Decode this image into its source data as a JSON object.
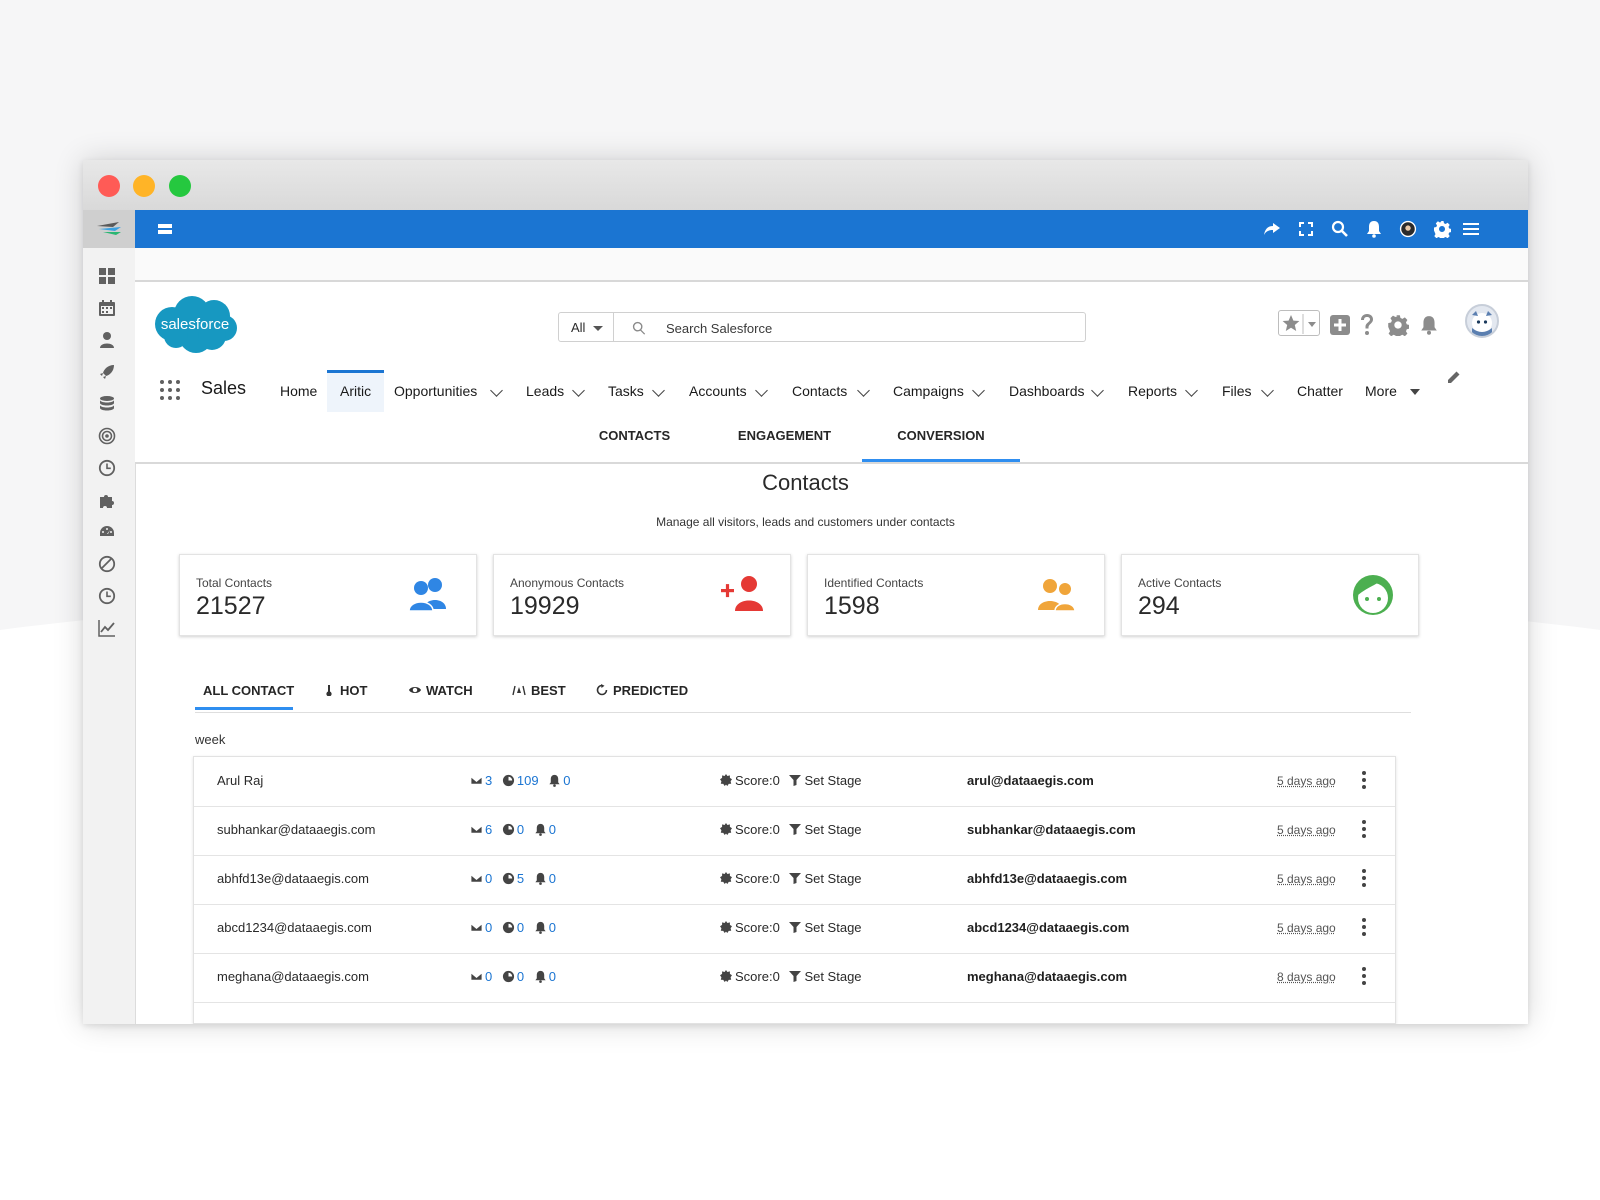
{
  "app": {
    "name": "Sales"
  },
  "search": {
    "scope": "All",
    "placeholder": "Search Salesforce"
  },
  "nav": {
    "items": [
      {
        "label": "Home",
        "dropdown": false
      },
      {
        "label": "Aritic",
        "dropdown": false,
        "active": true
      },
      {
        "label": "Opportunities",
        "dropdown": true
      },
      {
        "label": "Leads",
        "dropdown": true
      },
      {
        "label": "Tasks",
        "dropdown": true
      },
      {
        "label": "Accounts",
        "dropdown": true
      },
      {
        "label": "Contacts",
        "dropdown": true
      },
      {
        "label": "Campaigns",
        "dropdown": true
      },
      {
        "label": "Dashboards",
        "dropdown": true
      },
      {
        "label": "Reports",
        "dropdown": true
      },
      {
        "label": "Files",
        "dropdown": true
      },
      {
        "label": "Chatter",
        "dropdown": false
      },
      {
        "label": "More",
        "dropdown": true
      }
    ]
  },
  "subtabs": [
    {
      "label": "CONTACTS"
    },
    {
      "label": "ENGAGEMENT"
    },
    {
      "label": "CONVERSION",
      "active": true
    }
  ],
  "page": {
    "title": "Contacts",
    "subtitle": "Manage all visitors, leads and customers under contacts"
  },
  "stats": [
    {
      "label": "Total Contacts",
      "value": "21527",
      "icon": "people-icon",
      "color": "#2f86e4"
    },
    {
      "label": "Anonymous Contacts",
      "value": "19929",
      "icon": "add-person-icon",
      "color": "#e53935"
    },
    {
      "label": "Identified Contacts",
      "value": "1598",
      "icon": "people-icon",
      "color": "#f0a53a"
    },
    {
      "label": "Active Contacts",
      "value": "294",
      "icon": "smiley-face-icon",
      "color": "#4caf50"
    }
  ],
  "filter_tabs": [
    {
      "label": "ALL CONTACT",
      "icon": "",
      "active": true
    },
    {
      "label": "HOT",
      "icon": "thermometer-icon"
    },
    {
      "label": "WATCH",
      "icon": "eye-icon"
    },
    {
      "label": "BEST",
      "icon": "badge-icon"
    },
    {
      "label": "PREDICTED",
      "icon": "refresh-icon"
    }
  ],
  "group_label": "week",
  "contacts": [
    {
      "name": "Arul Raj",
      "emails": "3",
      "visits": "109",
      "alerts": "0",
      "score": "Score:0",
      "stage": "Set Stage",
      "email": "arul@dataaegis.com",
      "time": "5 days ago"
    },
    {
      "name": "subhankar@dataaegis.com",
      "emails": "6",
      "visits": "0",
      "alerts": "0",
      "score": "Score:0",
      "stage": "Set Stage",
      "email": "subhankar@dataaegis.com",
      "time": "5 days ago"
    },
    {
      "name": "abhfd13e@dataaegis.com",
      "emails": "0",
      "visits": "5",
      "alerts": "0",
      "score": "Score:0",
      "stage": "Set Stage",
      "email": "abhfd13e@dataaegis.com",
      "time": "5 days ago"
    },
    {
      "name": "abcd1234@dataaegis.com",
      "emails": "0",
      "visits": "0",
      "alerts": "0",
      "score": "Score:0",
      "stage": "Set Stage",
      "email": "abcd1234@dataaegis.com",
      "time": "5 days ago"
    },
    {
      "name": "meghana@dataaegis.com",
      "emails": "0",
      "visits": "0",
      "alerts": "0",
      "score": "Score:0",
      "stage": "Set Stage",
      "email": "meghana@dataaegis.com",
      "time": "8 days ago"
    }
  ],
  "logo": {
    "text": "salesforce",
    "color": "#1798c1"
  },
  "colors": {
    "brand_blue": "#1b75d2",
    "link_blue": "#1b75d2",
    "tab_accent": "#2f8ef0"
  }
}
